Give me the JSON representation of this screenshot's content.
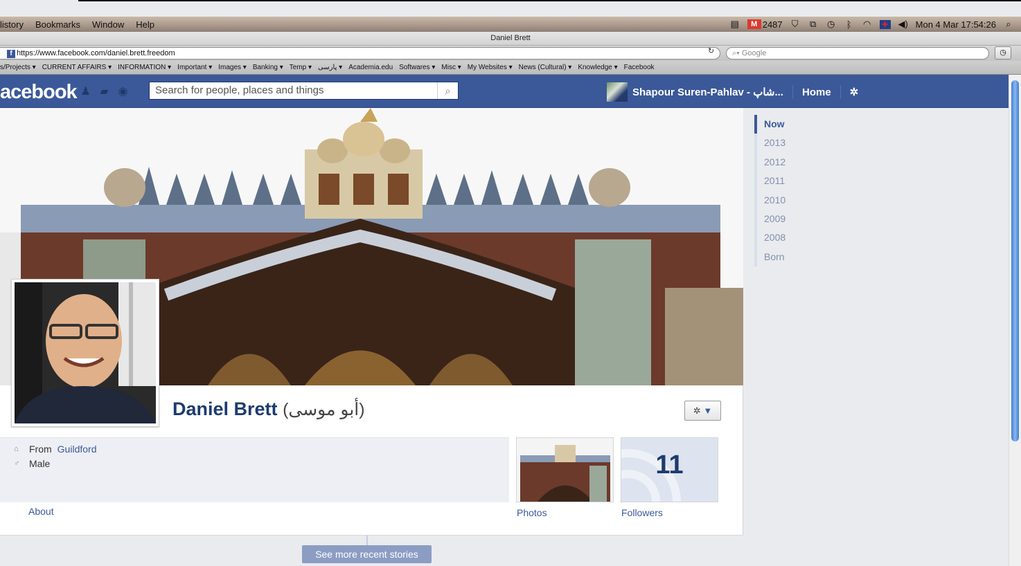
{
  "menubar": {
    "items": [
      "listory",
      "Bookmarks",
      "Window",
      "Help"
    ],
    "mail_count": "2487",
    "datetime": "Mon 4 Mar  17:54:26"
  },
  "window": {
    "title": "Daniel Brett"
  },
  "address": {
    "url": "https://www.facebook.com/daniel.brett.freedom",
    "search_placeholder": "Google"
  },
  "bookmarks": [
    "s/Projects ▾",
    "CURRENT AFFAIRS ▾",
    "INFORMATION ▾",
    "Important ▾",
    "Images ▾",
    "Banking ▾",
    "Temp ▾",
    "پارسی ▾",
    "Academia.edu",
    "Softwares ▾",
    "Misc ▾",
    "My Websites ▾",
    "News (Cultural) ▾",
    "Knowledge ▾",
    "Facebook"
  ],
  "fb": {
    "logo": "acebook",
    "search_placeholder": "Search for people, places and things",
    "user_name": "Shapour Suren-Pahlav - شاپ...",
    "home_label": "Home"
  },
  "profile": {
    "name": "Daniel Brett",
    "alt_name": "(أبو موسى)",
    "from_prefix": "From",
    "from_place": "Guildford",
    "gender": "Male",
    "about_label": "About",
    "photos_label": "Photos",
    "followers_label": "Followers",
    "followers_count": "11",
    "see_more": "See more recent stories"
  },
  "timeline_years": [
    "Now",
    "2013",
    "2012",
    "2011",
    "2010",
    "2009",
    "2008",
    "Born"
  ],
  "colors": {
    "fb_blue": "#3b5998",
    "link": "#3b5998",
    "active_year": "#3b5998"
  }
}
